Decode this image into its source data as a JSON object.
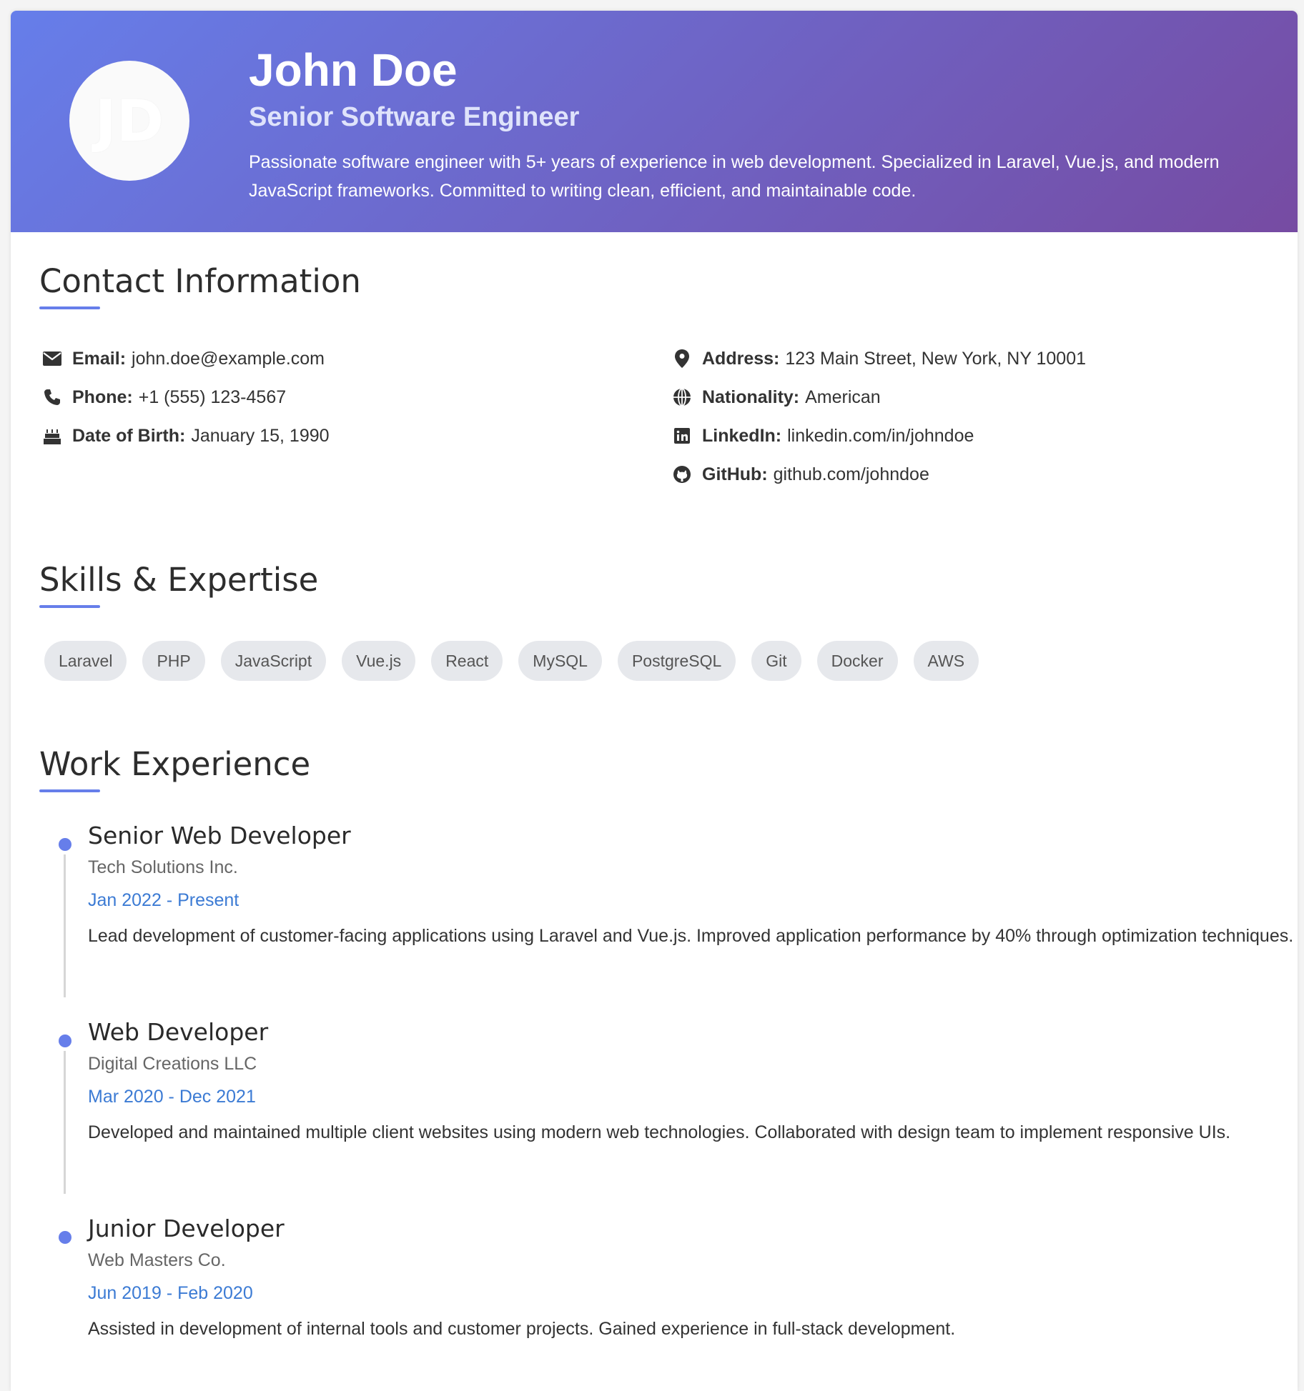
{
  "header": {
    "initials": "JD",
    "name": "John Doe",
    "role": "Senior Software Engineer",
    "summary": "Passionate software engineer with 5+ years of experience in web development. Specialized in Laravel, Vue.js, and modern JavaScript frameworks. Committed to writing clean, efficient, and maintainable code."
  },
  "contact": {
    "title": "Contact Information",
    "email": {
      "label": "Email:",
      "value": "john.doe@example.com",
      "icon": "envelope-icon"
    },
    "phone": {
      "label": "Phone:",
      "value": "+1 (555) 123-4567",
      "icon": "phone-icon"
    },
    "dob": {
      "label": "Date of Birth:",
      "value": "January 15, 1990",
      "icon": "birthday-cake-icon"
    },
    "address": {
      "label": "Address:",
      "value": "123 Main Street, New York, NY 10001",
      "icon": "map-pin-icon"
    },
    "nationality": {
      "label": "Nationality:",
      "value": "American",
      "icon": "globe-icon"
    },
    "linkedin": {
      "label": "LinkedIn:",
      "value": "linkedin.com/in/johndoe",
      "icon": "linkedin-icon"
    },
    "github": {
      "label": "GitHub:",
      "value": "github.com/johndoe",
      "icon": "github-icon"
    }
  },
  "skills": {
    "title": "Skills & Expertise",
    "items": [
      "Laravel",
      "PHP",
      "JavaScript",
      "Vue.js",
      "React",
      "MySQL",
      "PostgreSQL",
      "Git",
      "Docker",
      "AWS"
    ]
  },
  "experience": {
    "title": "Work Experience",
    "jobs": [
      {
        "title": "Senior Web Developer",
        "company": "Tech Solutions Inc.",
        "dates": "Jan 2022 - Present",
        "description": "Lead development of customer-facing applications using Laravel and Vue.js. Improved application performance by 40% through optimization techniques."
      },
      {
        "title": "Web Developer",
        "company": "Digital Creations LLC",
        "dates": "Mar 2020 - Dec 2021",
        "description": "Developed and maintained multiple client websites using modern web technologies. Collaborated with design team to implement responsive UIs."
      },
      {
        "title": "Junior Developer",
        "company": "Web Masters Co.",
        "dates": "Jun 2019 - Feb 2020",
        "description": "Assisted in development of internal tools and customer projects. Gained experience in full-stack development."
      }
    ]
  },
  "colors": {
    "gradient_start": "#667eea",
    "gradient_end": "#764ba2",
    "accent": "#667eea",
    "date_blue": "#3c7bd4"
  }
}
